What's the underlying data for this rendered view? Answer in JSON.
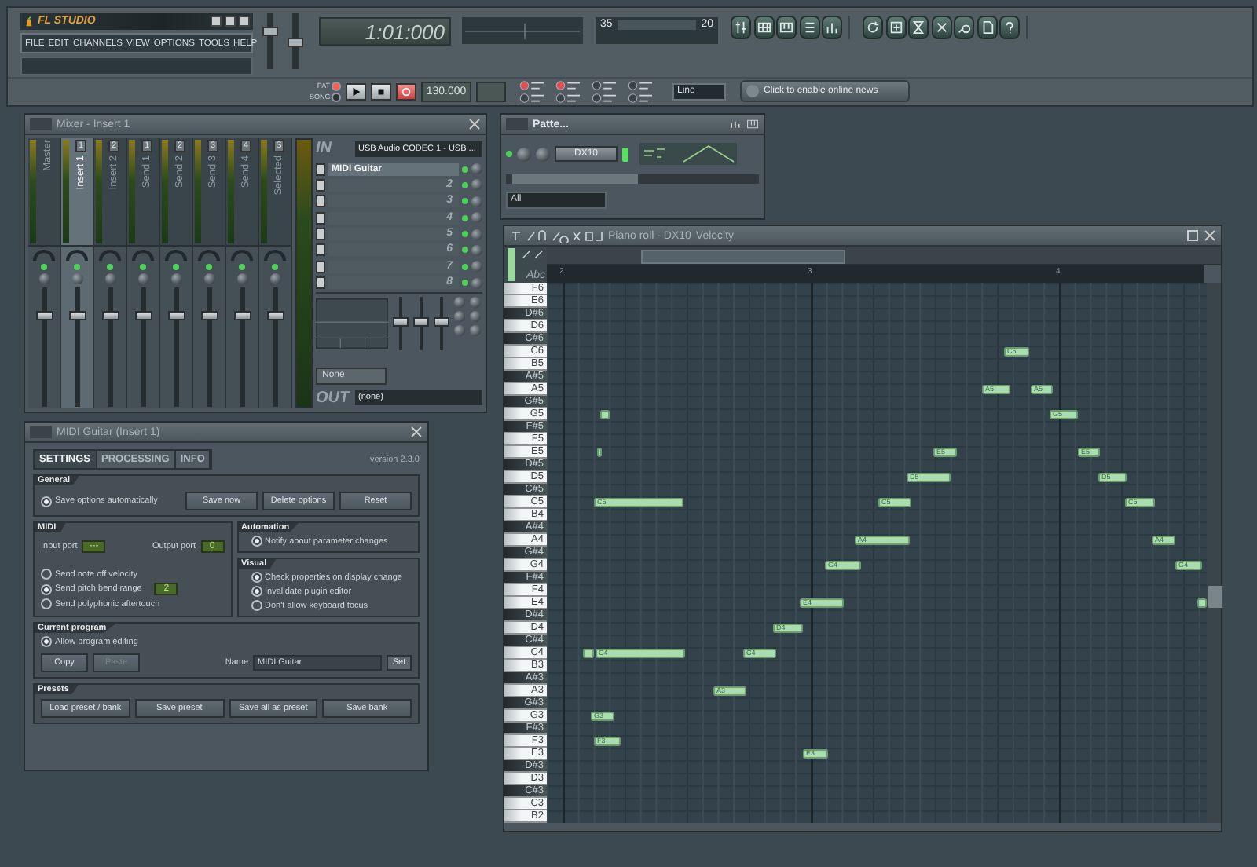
{
  "main": {
    "logo": "FL STUDIO",
    "menu": [
      "FILE",
      "EDIT",
      "CHANNELS",
      "VIEW",
      "OPTIONS",
      "TOOLS",
      "HELP"
    ],
    "master_volume": {
      "level": 0.75
    },
    "master_pitch": {
      "level": 0.5
    },
    "time": "1:01:000",
    "cpu": "35",
    "polyphony": "20",
    "modes": [
      {
        "label": "PAT",
        "selected": true
      },
      {
        "label": "SONG",
        "selected": false
      }
    ],
    "tempo": "130.000",
    "snap": "Line",
    "news": "Click to enable online news"
  },
  "mixer": {
    "title": "Mixer - Insert 1",
    "tracks": [
      {
        "name": "Master",
        "selected": false,
        "level": 0.78
      },
      {
        "name": "Insert 1",
        "number": "1",
        "selected": true,
        "level": 0.78
      },
      {
        "name": "Insert 2",
        "number": "2",
        "selected": false,
        "level": 0.78
      },
      {
        "name": "Send 1",
        "number": "1",
        "selected": false,
        "level": 0.78
      },
      {
        "name": "Send 2",
        "number": "2",
        "selected": false,
        "level": 0.78
      },
      {
        "name": "Send 3",
        "number": "3",
        "selected": false,
        "level": 0.78
      },
      {
        "name": "Send 4",
        "number": "4",
        "selected": false,
        "level": 0.78
      },
      {
        "name": "Selected",
        "number": "S",
        "selected": false,
        "level": 0.78
      }
    ],
    "in_label": "IN",
    "input": "USB Audio CODEC  1 - USB ...",
    "slots": [
      "MIDI Guitar",
      "2",
      "3",
      "4",
      "5",
      "6",
      "7",
      "8"
    ],
    "eq_faders": [
      {
        "level": 0.5
      },
      {
        "level": 0.5
      },
      {
        "level": 0.5
      }
    ],
    "preset": "None",
    "out_label": "OUT",
    "output": "(none)"
  },
  "channel_rack": {
    "title": "Patte...",
    "channel": "DX10",
    "filter": "All"
  },
  "plugin": {
    "title": "MIDI Guitar (Insert 1)",
    "tabs": [
      {
        "label": "SETTINGS",
        "selected": true
      },
      {
        "label": "PROCESSING",
        "selected": false
      },
      {
        "label": "INFO",
        "selected": false
      }
    ],
    "version": "version 2.3.0",
    "general": {
      "heading": "General",
      "options": [
        {
          "label": "Save options automatically",
          "checked": true
        }
      ],
      "buttons": [
        "Save now",
        "Delete options",
        "Reset"
      ]
    },
    "midi": {
      "heading": "MIDI",
      "input_label": "Input port",
      "input_value": "---",
      "output_label": "Output port",
      "output_value": "0",
      "options": [
        {
          "label": "Send note off velocity",
          "checked": false
        },
        {
          "label": "Send pitch bend range",
          "checked": true,
          "value": "2"
        },
        {
          "label": "Send polyphonic aftertouch",
          "checked": false
        }
      ]
    },
    "automation": {
      "heading": "Automation",
      "options": [
        {
          "label": "Notify about parameter changes",
          "checked": true
        }
      ]
    },
    "visual": {
      "heading": "Visual",
      "options": [
        {
          "label": "Check properties on display change",
          "checked": true
        },
        {
          "label": "Invalidate plugin editor",
          "checked": true
        },
        {
          "label": "Don't allow keyboard focus",
          "checked": false
        }
      ]
    },
    "current_program": {
      "heading": "Current program",
      "options": [
        {
          "label": "Allow program editing",
          "checked": true
        }
      ],
      "buttons": [
        {
          "label": "Copy",
          "disabled": false
        },
        {
          "label": "Paste",
          "disabled": true
        }
      ],
      "name_label": "Name",
      "name_value": "MIDI Guitar",
      "set": "Set"
    },
    "presets": {
      "heading": "Presets",
      "buttons": [
        "Load preset / bank",
        "Save preset",
        "Save all as preset",
        "Save bank"
      ]
    }
  },
  "piano_roll": {
    "title": "Piano roll - DX10",
    "mode": "Velocity",
    "corner_label": "Abc",
    "ruler": [
      "2",
      "3",
      "4"
    ],
    "keys": [
      {
        "label": "F6",
        "black": false
      },
      {
        "label": "E6",
        "black": false
      },
      {
        "label": "D#6",
        "black": true
      },
      {
        "label": "D6",
        "black": false
      },
      {
        "label": "C#6",
        "black": true
      },
      {
        "label": "C6",
        "black": false
      },
      {
        "label": "B5",
        "black": false
      },
      {
        "label": "A#5",
        "black": true
      },
      {
        "label": "A5",
        "black": false
      },
      {
        "label": "G#5",
        "black": true
      },
      {
        "label": "G5",
        "black": false
      },
      {
        "label": "F#5",
        "black": true
      },
      {
        "label": "F5",
        "black": false
      },
      {
        "label": "E5",
        "black": false
      },
      {
        "label": "D#5",
        "black": true
      },
      {
        "label": "D5",
        "black": false
      },
      {
        "label": "C#5",
        "black": true
      },
      {
        "label": "C5",
        "black": false
      },
      {
        "label": "B4",
        "black": false
      },
      {
        "label": "A#4",
        "black": true
      },
      {
        "label": "A4",
        "black": false
      },
      {
        "label": "G#4",
        "black": true
      },
      {
        "label": "G4",
        "black": false
      },
      {
        "label": "F#4",
        "black": true
      },
      {
        "label": "F4",
        "black": false
      },
      {
        "label": "E4",
        "black": false
      },
      {
        "label": "D#4",
        "black": true
      },
      {
        "label": "D4",
        "black": false
      },
      {
        "label": "C#4",
        "black": true
      },
      {
        "label": "C4",
        "black": false
      },
      {
        "label": "B3",
        "black": false
      },
      {
        "label": "A#3",
        "black": true
      },
      {
        "label": "A3",
        "black": false
      },
      {
        "label": "G#3",
        "black": true
      },
      {
        "label": "G3",
        "black": false
      },
      {
        "label": "F#3",
        "black": true
      },
      {
        "label": "F3",
        "black": false
      },
      {
        "label": "E3",
        "black": false
      },
      {
        "label": "D#3",
        "black": true
      },
      {
        "label": "D3",
        "black": false
      },
      {
        "label": "C#3",
        "black": true
      },
      {
        "label": "C3",
        "black": false
      },
      {
        "label": "B2",
        "black": false
      }
    ],
    "notes": [
      {
        "kind": "labeled",
        "label": "C6"
      },
      {
        "kind": "labeled",
        "label": "A5"
      },
      {
        "kind": "labeled",
        "label": "A5"
      },
      {
        "kind": "blank"
      },
      {
        "kind": "labeled",
        "label": "G5"
      },
      {
        "kind": "blank"
      },
      {
        "kind": "labeled",
        "label": "E5"
      },
      {
        "kind": "labeled",
        "label": "E5"
      },
      {
        "kind": "labeled",
        "label": "D5"
      },
      {
        "kind": "labeled",
        "label": "D5"
      },
      {
        "kind": "labeled",
        "label": "C5"
      },
      {
        "kind": "labeled",
        "label": "C5"
      },
      {
        "kind": "labeled",
        "label": "C5"
      },
      {
        "kind": "labeled",
        "label": "A4"
      },
      {
        "kind": "labeled",
        "label": "A4"
      },
      {
        "kind": "labeled",
        "label": "G4"
      },
      {
        "kind": "labeled",
        "label": "G4"
      },
      {
        "kind": "labeled",
        "label": "E4"
      },
      {
        "kind": "blank"
      },
      {
        "kind": "labeled",
        "label": "D4"
      },
      {
        "kind": "blank"
      },
      {
        "kind": "labeled",
        "label": "C4"
      },
      {
        "kind": "labeled",
        "label": "C4"
      },
      {
        "kind": "labeled",
        "label": "A3"
      },
      {
        "kind": "labeled",
        "label": "G3"
      },
      {
        "kind": "labeled",
        "label": "F3"
      },
      {
        "kind": "labeled",
        "label": "E3"
      }
    ]
  }
}
